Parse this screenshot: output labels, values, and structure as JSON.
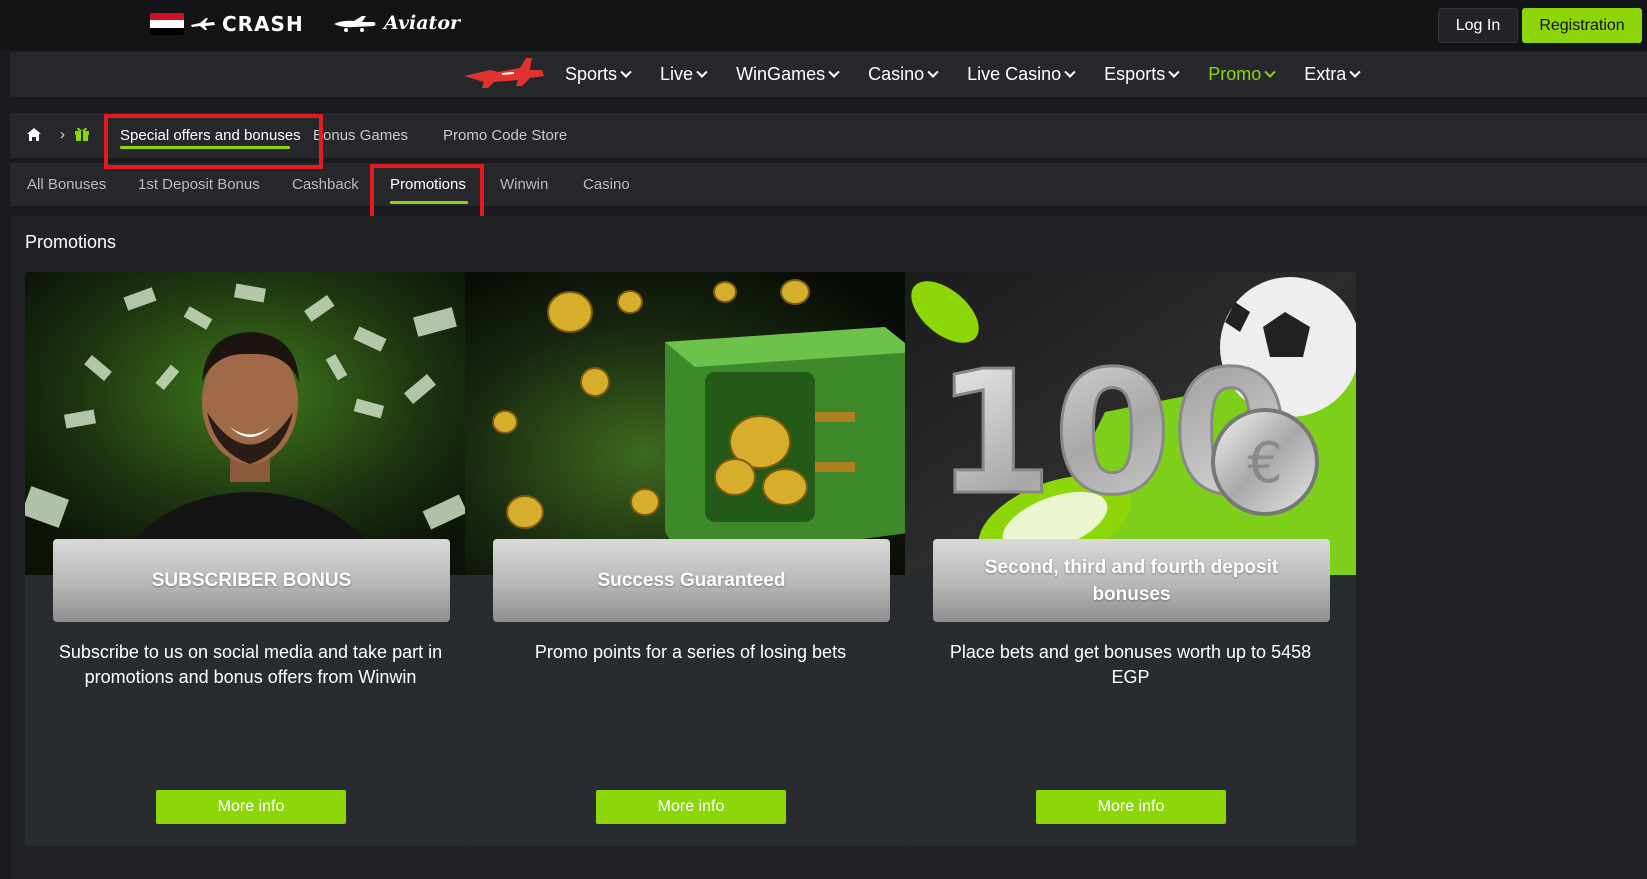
{
  "header": {
    "crash_label": "CRASH",
    "aviator_label": "Aviator",
    "login_label": "Log In",
    "register_label": "Registration",
    "accent_color": "#8dd60a"
  },
  "nav": {
    "items": [
      {
        "label": "Sports"
      },
      {
        "label": "Live"
      },
      {
        "label": "WinGames"
      },
      {
        "label": "Casino"
      },
      {
        "label": "Live Casino"
      },
      {
        "label": "Esports"
      },
      {
        "label": "Promo",
        "active": true
      },
      {
        "label": "Extra"
      }
    ]
  },
  "breadcrumb": {
    "icons": [
      "home-icon",
      "chevron-right-icon",
      "gift-icon"
    ],
    "tabs": [
      {
        "label": "Special offers and bonuses",
        "active": true
      },
      {
        "label": "Bonus Games"
      },
      {
        "label": "Promo Code Store"
      }
    ]
  },
  "subtabs": [
    {
      "label": "All Bonuses"
    },
    {
      "label": "1st Deposit Bonus"
    },
    {
      "label": "Cashback"
    },
    {
      "label": "Promotions",
      "active": true
    },
    {
      "label": "Winwin"
    },
    {
      "label": "Casino"
    }
  ],
  "section_title": "Promotions",
  "cards": [
    {
      "title": "SUBSCRIBER BONUS",
      "description": "Subscribe to us on social media and take part in promotions and bonus offers from Winwin",
      "button": "More info"
    },
    {
      "title": "Success Guaranteed",
      "description": "Promo points for a series of losing bets",
      "button": "More info"
    },
    {
      "title": "Second, third and fourth deposit bonuses",
      "description": "Place bets and get bonuses worth up to 5458 EGP",
      "button": "More info",
      "image_text": "100"
    }
  ]
}
